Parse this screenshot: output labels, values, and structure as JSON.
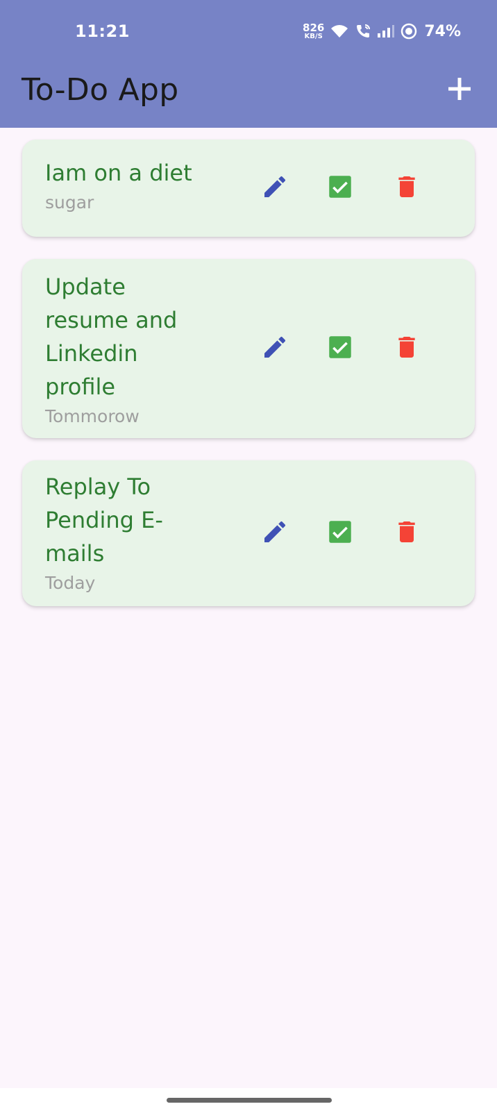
{
  "status_bar": {
    "time": "11:21",
    "net_speed_value": "826",
    "net_speed_unit": "KB/S",
    "battery": "74%"
  },
  "app_bar": {
    "title": "To-Do App",
    "add_icon": "plus-icon"
  },
  "colors": {
    "app_bar": "#7783c6",
    "card_background": "#e8f4e8",
    "title_text": "#2e7d32",
    "subtitle_text": "#9e9e9e",
    "edit_icon": "#3f51b5",
    "done_icon": "#4caf50",
    "delete_icon": "#f44336"
  },
  "tasks": [
    {
      "title": "Iam on a diet",
      "subtitle": "sugar",
      "icons": [
        "edit-icon",
        "checkbox-checked-icon",
        "delete-icon"
      ]
    },
    {
      "title": "Update resume and Linkedin profile",
      "subtitle": "Tommorow",
      "icons": [
        "edit-icon",
        "checkbox-checked-icon",
        "delete-icon"
      ]
    },
    {
      "title": "Replay To Pending E-mails",
      "subtitle": "Today",
      "icons": [
        "edit-icon",
        "checkbox-checked-icon",
        "delete-icon"
      ]
    }
  ]
}
